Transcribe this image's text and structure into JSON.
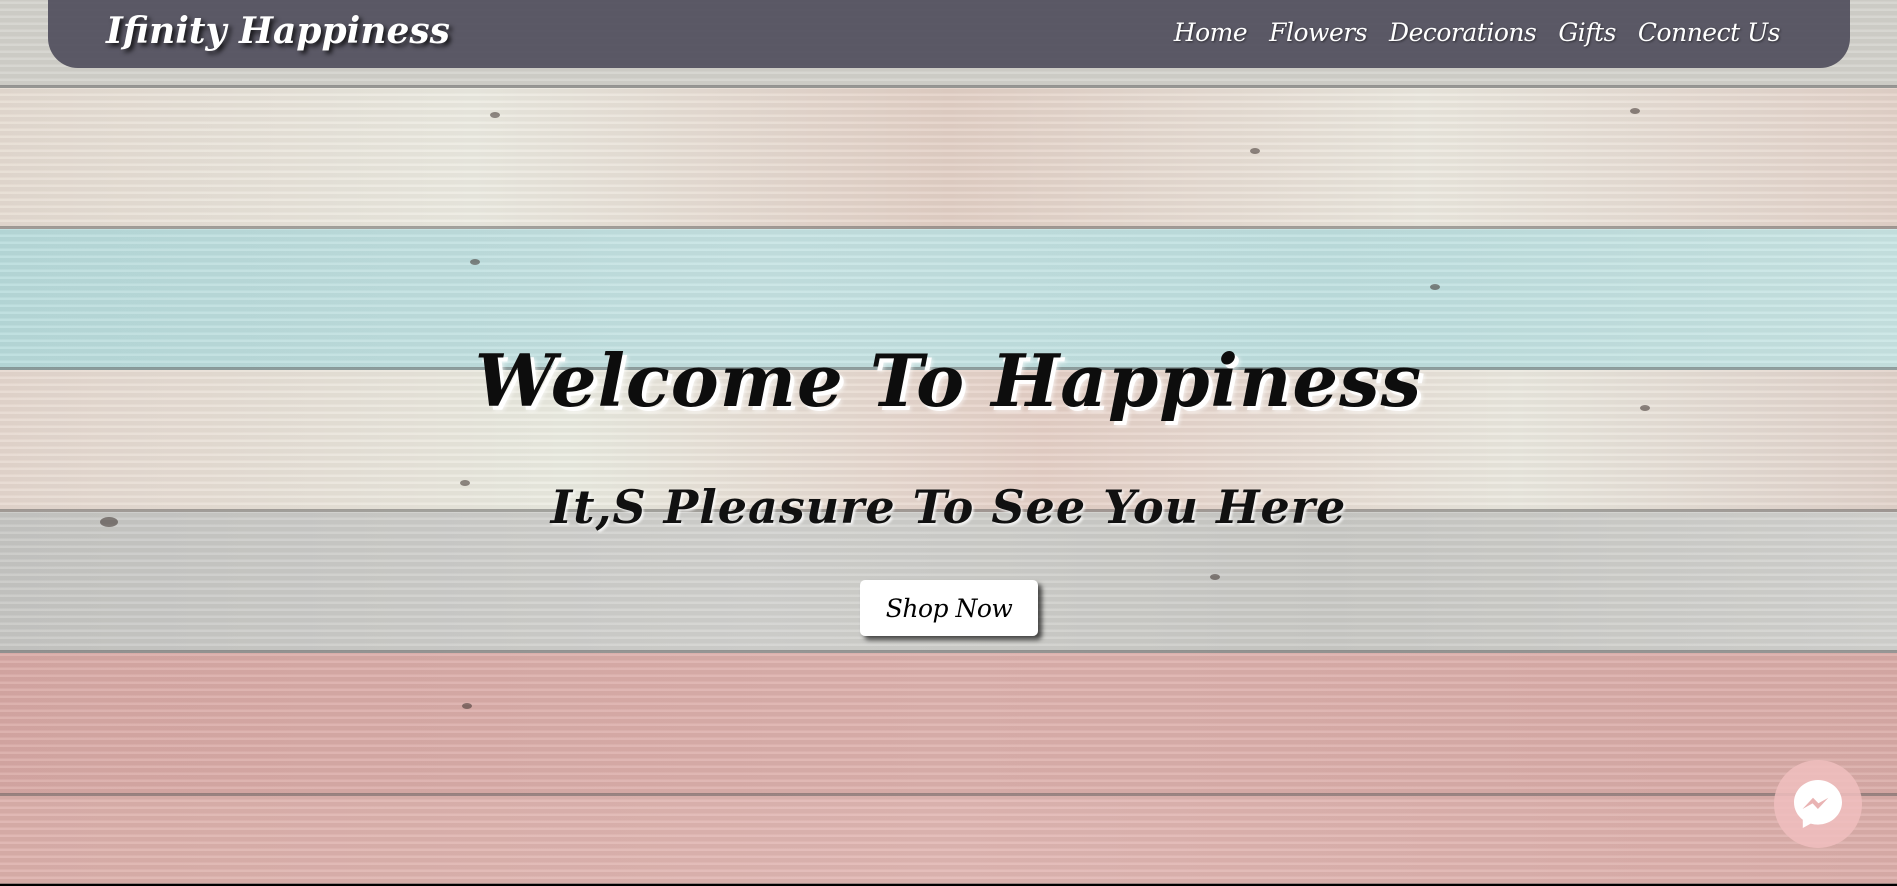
{
  "navbar": {
    "brand": "Ifinity Happiness",
    "links": [
      {
        "label": "Home"
      },
      {
        "label": "Flowers"
      },
      {
        "label": "Decorations"
      },
      {
        "label": "Gifts"
      },
      {
        "label": "Connect Us"
      }
    ]
  },
  "hero": {
    "title": "Welcome To Happiness",
    "subtitle": "It,S Pleasure To See You Here",
    "cta_label": "Shop Now"
  },
  "floating": {
    "icon": "messenger-icon"
  },
  "colors": {
    "navbar_bg": "#504e5c",
    "button_bg": "#ffffff",
    "messenger_bubble": "#f0bebe"
  }
}
